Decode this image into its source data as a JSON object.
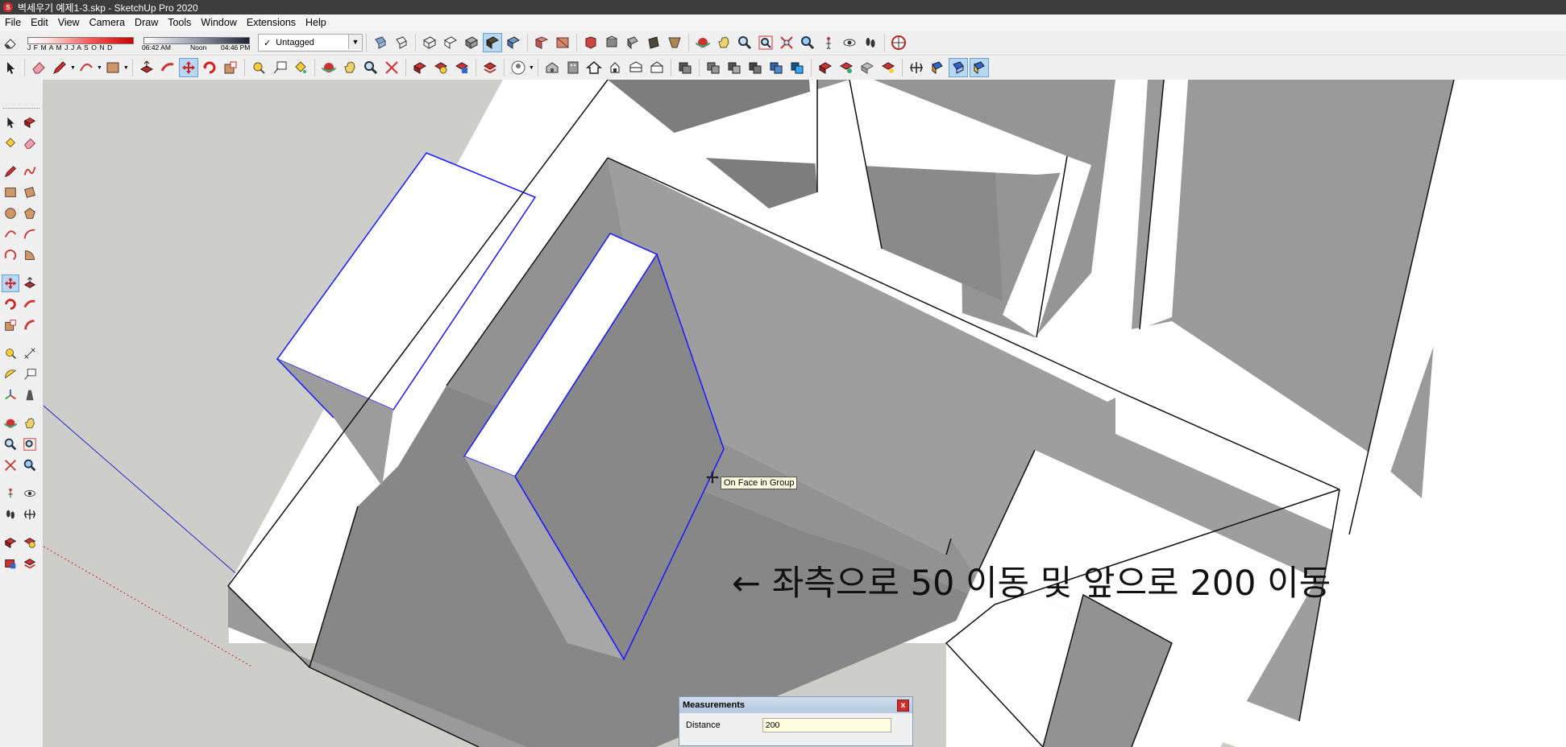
{
  "window": {
    "title": "벽세우기 예제1-3.skp - SketchUp Pro 2020"
  },
  "menu": [
    "File",
    "Edit",
    "View",
    "Camera",
    "Draw",
    "Tools",
    "Window",
    "Extensions",
    "Help"
  ],
  "shadow": {
    "months": "J F M A M J J A S O N D",
    "time_start": "06:42 AM",
    "time_mid": "Noon",
    "time_end": "04:46 PM"
  },
  "tag": {
    "selected": "Untagged",
    "check": "✓"
  },
  "viewport": {
    "tooltip": "On Face in Group",
    "annotation": "← 좌측으로 50 이동 및 앞으로 200 이동"
  },
  "measurements": {
    "title": "Measurements",
    "label": "Distance",
    "value": "200"
  },
  "colors": {
    "selection_edge": "#0000ff",
    "face_white": "#ffffff",
    "face_gray": "#8a8a8a",
    "ground": "#cdcdca",
    "active_tool": "#b8d7f2"
  },
  "icons": {
    "toolbar_row1": [
      "eraser-icon",
      "style-xray-icon",
      "style-backedges-icon",
      "style-wireframe-icon",
      "style-hiddenline-icon",
      "style-shaded-icon",
      "style-textured-icon",
      "style-monochrome-icon",
      "iso-view-icon",
      "top-view-icon",
      "front-view-icon",
      "right-view-icon",
      "back-view-icon",
      "left-view-icon",
      "bottom-view-icon",
      "orbit-icon",
      "pan-icon",
      "zoom-icon",
      "zoom-window-icon",
      "zoom-extents-icon",
      "previous-view-icon",
      "position-camera-icon",
      "look-around-icon",
      "walk-icon",
      "warehouse-icon"
    ],
    "toolbar_row2": [
      "select-icon",
      "eraser-icon",
      "pencil-icon",
      "arc-icon",
      "rectangle-icon",
      "push-pull-icon",
      "follow-me-icon",
      "move-icon",
      "rotate-icon",
      "scale-icon",
      "tape-measure-icon",
      "text-icon",
      "paint-bucket-icon",
      "orbit-icon",
      "pan-icon",
      "zoom-icon",
      "zoom-extents-icon",
      "component-icon",
      "group-icon",
      "warehouse-icon",
      "layers-icon",
      "user-icon",
      "sandbox-icon",
      "building-icon",
      "house-icon",
      "house-outline-icon",
      "box-icon",
      "section-icon",
      "solid-union-icon",
      "solid-subtract-icon",
      "solid-trim-icon",
      "solid-intersect-icon",
      "solid-split-icon",
      "shell-icon",
      "dynamic-component-icon",
      "interact-icon",
      "options-icon",
      "attributes-icon",
      "section-plane-icon",
      "section-display-icon",
      "section-fill-icon",
      "section-cut-icon"
    ]
  }
}
